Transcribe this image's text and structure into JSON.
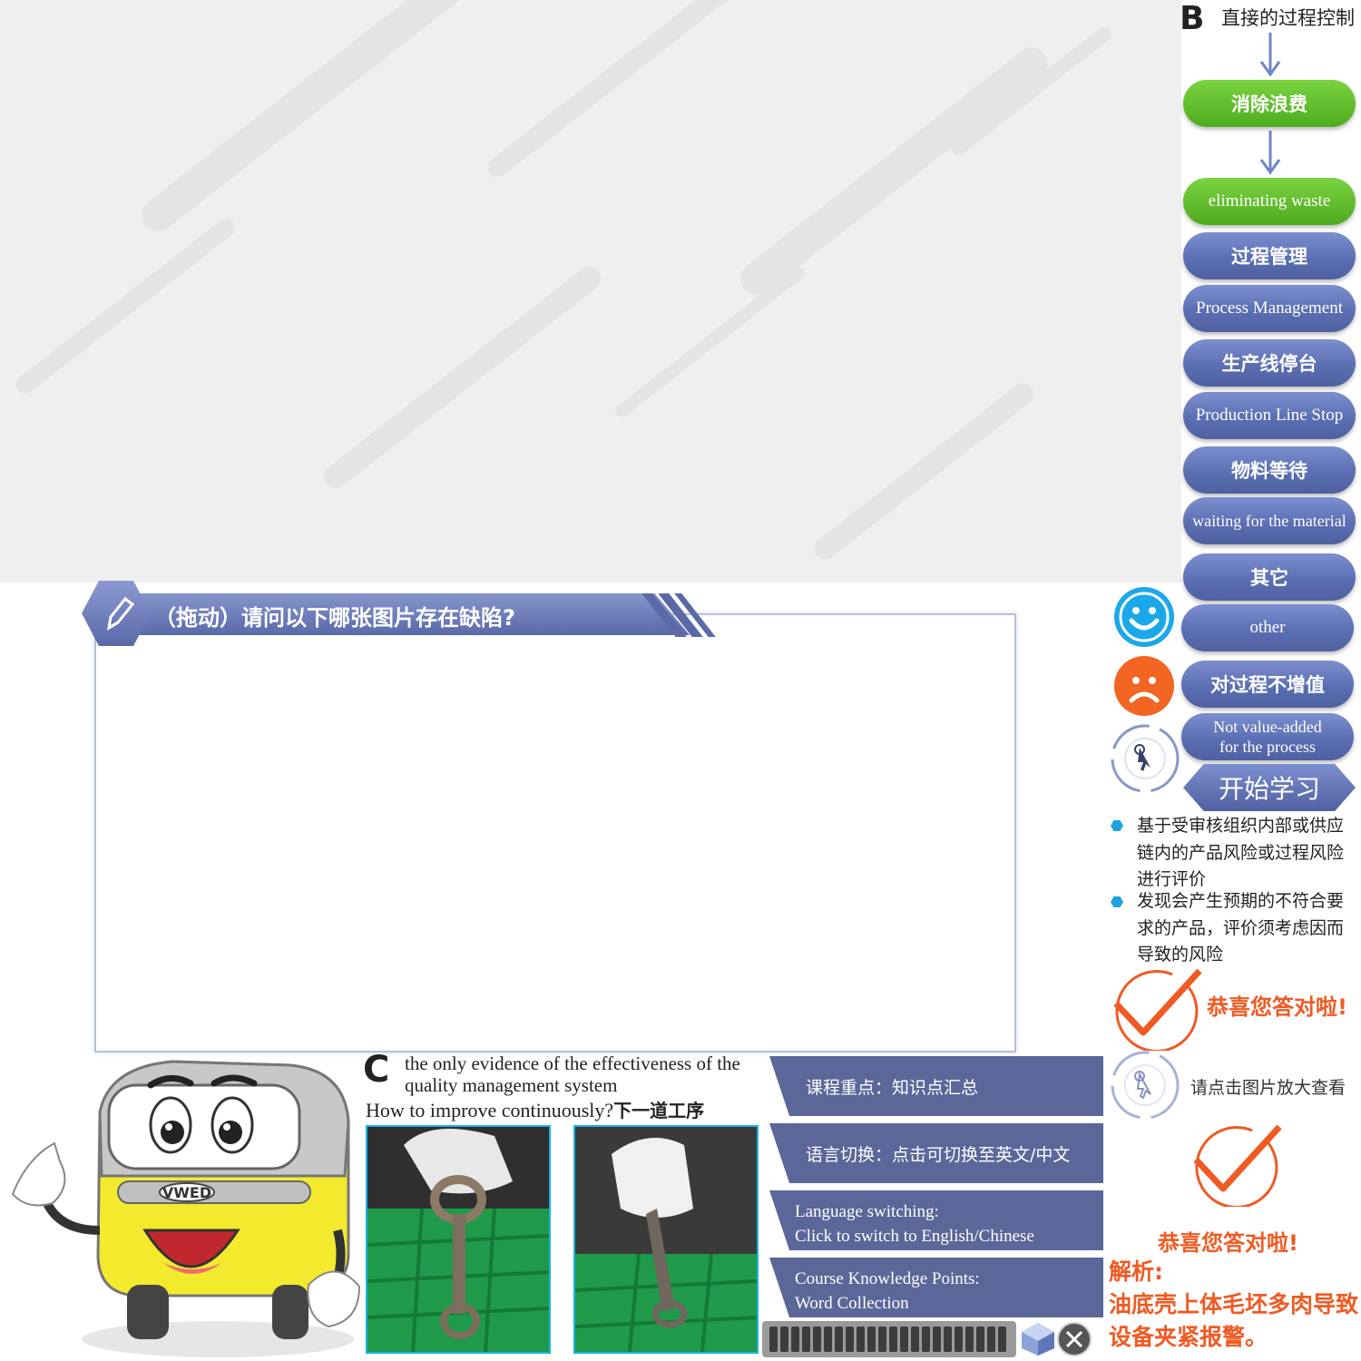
{
  "process_flow": {
    "marker": "B",
    "title": "直接的过程控制",
    "items": [
      {
        "label": "消除浪费",
        "style": "green",
        "lang": "cn"
      },
      {
        "label": "eliminating waste",
        "style": "green",
        "lang": "en"
      },
      {
        "label": "过程管理",
        "style": "blue",
        "lang": "cn"
      },
      {
        "label": "Process Management",
        "style": "blue",
        "lang": "en"
      },
      {
        "label": "生产线停台",
        "style": "blue",
        "lang": "cn"
      },
      {
        "label": "Production Line Stop",
        "style": "blue",
        "lang": "en"
      },
      {
        "label": "物料等待",
        "style": "blue",
        "lang": "cn"
      },
      {
        "label": "waiting for the material",
        "style": "blue",
        "lang": "en"
      },
      {
        "label": "其它",
        "style": "blue",
        "lang": "cn"
      },
      {
        "label": "other",
        "style": "blue",
        "lang": "en"
      },
      {
        "label": "对过程不增值",
        "style": "blue",
        "lang": "cn"
      },
      {
        "label_line1": "Not value-added",
        "label_line2": "for the process",
        "style": "blue",
        "lang": "en"
      }
    ]
  },
  "feedback": {
    "happy_icon": "smiley-face-icon",
    "sad_icon": "sad-face-icon",
    "pointer_icon": "cursor-click-icon",
    "start_button": "开始学习"
  },
  "bullets": [
    {
      "line1": "基于受审核组织内部或供应",
      "line2": "链内的产品风险或过程风险",
      "line3": "进行评价"
    },
    {
      "line1": "发现会产生预期的不符合要",
      "line2": "求的产品，评价须考虑因而",
      "line3": "导致的风险"
    }
  ],
  "success_message_1": "恭喜您答对啦!",
  "zoom_hint": "请点击图片放大查看",
  "success_message_2": "恭喜您答对啦!",
  "analysis": {
    "label": "解析:",
    "line1": "油底壳上体毛坯多肉导致",
    "line2": "设备夹紧报警。"
  },
  "question": {
    "text": "（拖动）请问以下哪张图片存在缺陷?",
    "icon": "pencil-icon"
  },
  "mascot": {
    "badge": "VWED"
  },
  "content_c": {
    "marker": "C",
    "line1": "the only evidence of the effectiveness of the",
    "line2": "quality management system",
    "line3_en": "How to improve continuously?",
    "line3_cn": "下一道工序"
  },
  "photos": [
    {
      "name": "connecting-rod-photo-1"
    },
    {
      "name": "connecting-rod-photo-2"
    }
  ],
  "menu": {
    "course_focus": "课程重点：知识点汇总",
    "language_cn": "语言切换：点击可切换至英文/中文",
    "language_en_line1": "Language switching:",
    "language_en_line2": "Click to switch to English/Chinese",
    "knowledge_line1": "Course Knowledge Points:",
    "knowledge_line2": "Word Collection"
  },
  "player": {
    "segments": 22,
    "cube_icon": "cube-icon",
    "close_icon": "close-icon"
  },
  "colors": {
    "accent_blue": "#5b6fb3",
    "accent_green": "#4fab1f",
    "success_red": "#f05a23",
    "bullet_blue": "#1fa2e0"
  }
}
